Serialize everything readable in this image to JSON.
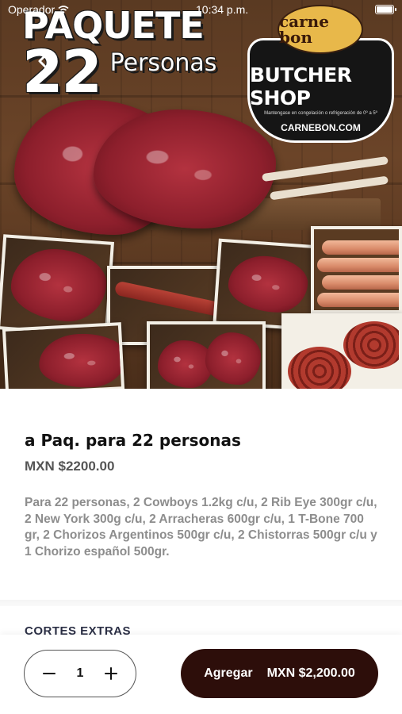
{
  "status_bar": {
    "carrier": "Operador",
    "time": "10:34 p.m.",
    "icons": [
      "wifi-icon",
      "battery-icon"
    ]
  },
  "hero": {
    "back_icon": "chevron-left-icon",
    "promo_word": "PAQUETE",
    "promo_number": "22",
    "promo_sub": "Personas",
    "brand_logo": "carne bon",
    "brand_name": "BUTCHER SHOP",
    "brand_tagline": "Mantengase en congelación o refrigeración de 0º a 5º",
    "brand_site": "CARNEBON.COM"
  },
  "product": {
    "title": "a Paq. para 22 personas",
    "price": "MXN $2200.00",
    "description": "Para 22 personas, 2 Cowboys 1.2kg c/u, 2 Rib Eye 300gr c/u, 2 New York 300g c/u, 2 Arracheras 600gr c/u, 1 T-Bone 700 gr, 2 Chorizos Argentinos 500gr c/u, 2 Chistorras 500gr c/u y 1 Chorizo español 500gr."
  },
  "extras": {
    "title": "CORTES EXTRAS"
  },
  "cart": {
    "quantity": "1",
    "minus_icon": "minus-icon",
    "plus_icon": "plus-icon",
    "add_label": "Agregar",
    "add_total": "MXN $2,200.00"
  },
  "colors": {
    "primary_button": "#2d0e0a",
    "price_text": "#555555",
    "description_text": "#8d8d8d"
  }
}
